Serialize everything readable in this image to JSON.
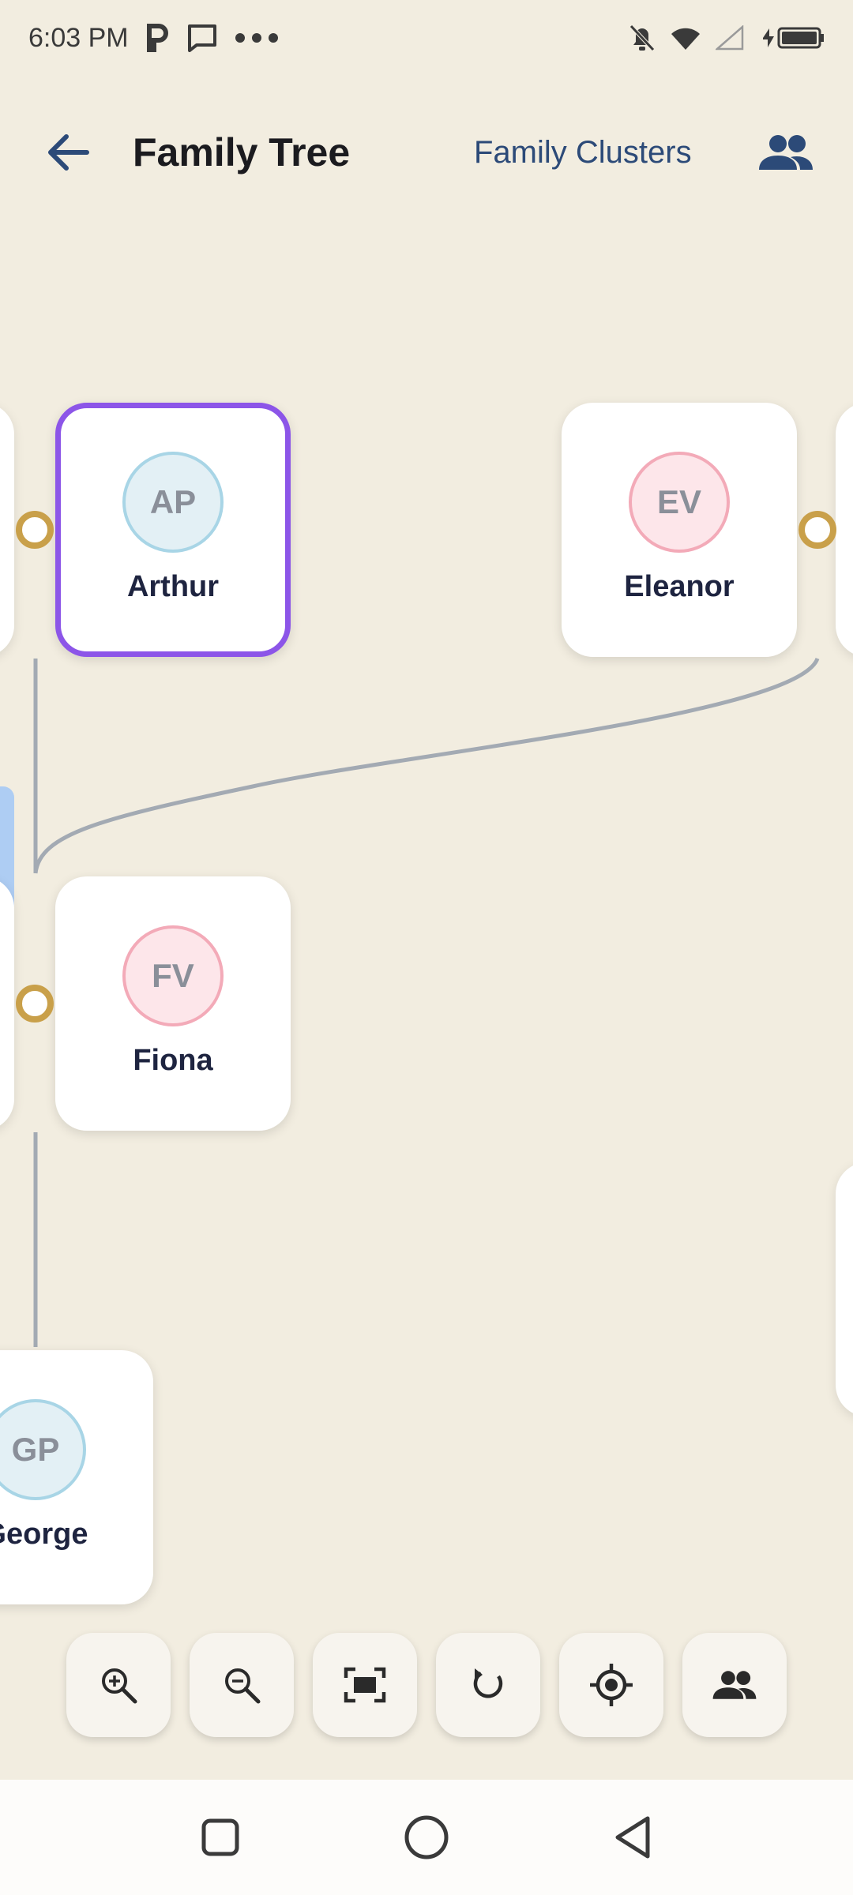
{
  "status_bar": {
    "time": "6:03 PM"
  },
  "app_bar": {
    "title": "Family Tree",
    "clusters_link": "Family Clusters"
  },
  "people": [
    {
      "initials": "AP",
      "name": "Arthur",
      "gender": "male",
      "selected": true
    },
    {
      "initials": "EV",
      "name": "Eleanor",
      "gender": "female",
      "selected": false
    },
    {
      "initials": "FV",
      "name": "Fiona",
      "gender": "female",
      "selected": false
    },
    {
      "initials": "GP",
      "name": "George",
      "gender": "male",
      "selected": false
    }
  ],
  "toolbar": {
    "buttons": [
      "zoom-in",
      "zoom-out",
      "fit-to-screen",
      "reset",
      "center",
      "family-clusters"
    ]
  },
  "colors": {
    "background": "#f2ede0",
    "selected_border": "#8c55e8",
    "node_dot": "#c9a04a",
    "connector": "#a3aab3",
    "link": "#2c4a78"
  }
}
